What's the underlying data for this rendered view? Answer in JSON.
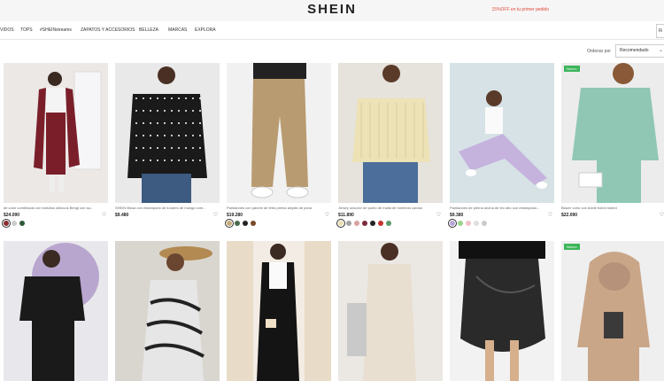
{
  "header": {
    "logo": "SHEIN",
    "promo": "15%OFF en tu primer pedido"
  },
  "nav": {
    "items": [
      "VIDOS",
      "TOPS",
      "#SHEINstreams",
      "ZAPATOS Y ACCESORIOS",
      "BELLEZA",
      "MARCAS",
      "EXPLORA"
    ],
    "right_label": "Ri"
  },
  "sort": {
    "label": "Ordenar por",
    "value": "Recomendado"
  },
  "products": [
    {
      "title": "de color combinado con bolsillos oblicuos Bengi con sa...",
      "price": "$24.090",
      "swatches": [
        "#8a2f33",
        "#cccccc",
        "#2f5a3a"
      ],
      "selected": 0,
      "badge": ""
    },
    {
      "title": "SHEIN Blusa con estampado de lunares de manga com...",
      "price": "$9.480",
      "swatches": [],
      "selected": -1,
      "badge": ""
    },
    {
      "title": "Pantalones con parche de letra pierna amplia de pana",
      "price": "$19.280",
      "swatches": [
        "#c8a97a",
        "#4a6a4f",
        "#222222",
        "#7a4a2a"
      ],
      "selected": 0,
      "badge": ""
    },
    {
      "title": "Jersey unicolor de punto de malla de hombros caídos",
      "price": "$11.890",
      "swatches": [
        "#e9e1b4",
        "#a3a3a3",
        "#d8a2a0",
        "#7a2c3a",
        "#222222",
        "#c43333",
        "#5a9a6a"
      ],
      "selected": 0,
      "badge": ""
    },
    {
      "title": "Pantalones de pierna ancha de tiro alto con estampado...",
      "price": "$9.380",
      "swatches": [
        "#b9a6d8",
        "#9ad38c",
        "#f0c0c8",
        "#e0e0e0",
        "#c9c9c9"
      ],
      "selected": 0,
      "badge": ""
    },
    {
      "title": "Blazer corto con doble botón tweed",
      "price": "$22.090",
      "swatches": [],
      "selected": -1,
      "badge": "Nuevo"
    },
    {
      "title": "",
      "price": "",
      "swatches": [],
      "selected": -1,
      "badge": ""
    },
    {
      "title": "",
      "price": "",
      "swatches": [],
      "selected": -1,
      "badge": ""
    },
    {
      "title": "",
      "price": "",
      "swatches": [],
      "selected": -1,
      "badge": ""
    },
    {
      "title": "",
      "price": "",
      "swatches": [],
      "selected": -1,
      "badge": ""
    },
    {
      "title": "",
      "price": "",
      "swatches": [],
      "selected": -1,
      "badge": ""
    },
    {
      "title": "",
      "price": "",
      "swatches": [],
      "selected": -1,
      "badge": "Nuevo"
    }
  ],
  "icons": {
    "heart": "heart-icon",
    "chevron": "chevron-down-icon"
  }
}
